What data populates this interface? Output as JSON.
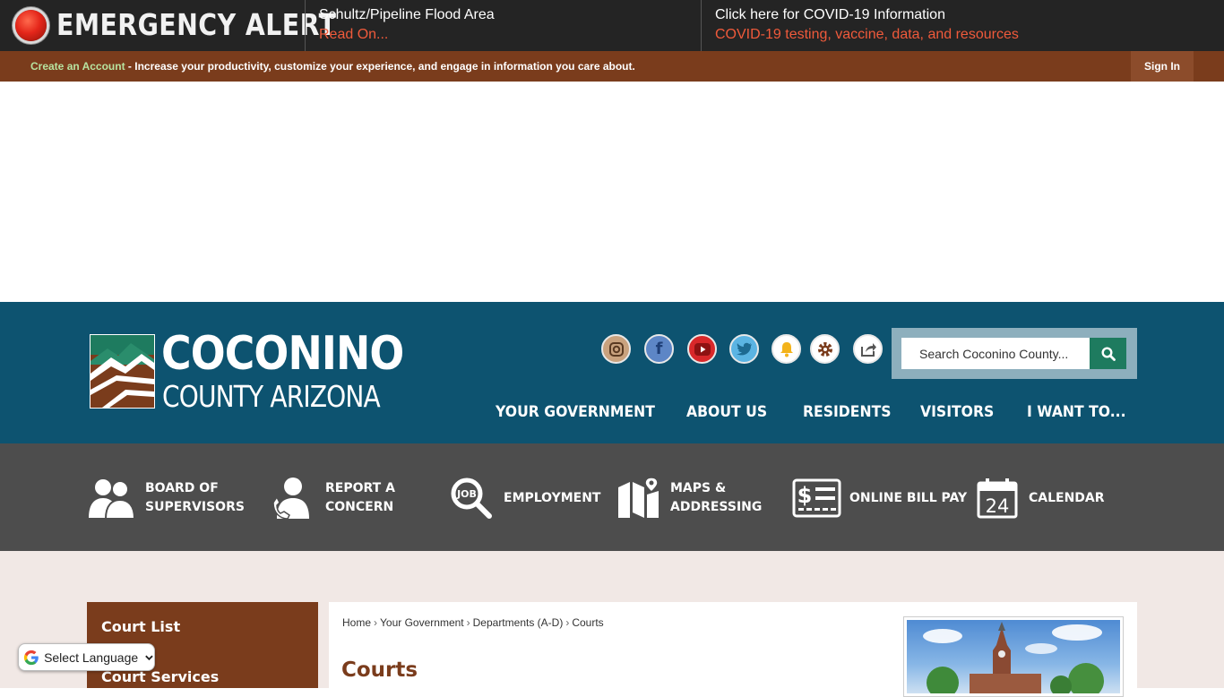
{
  "alert": {
    "title": "EMERGENCY ALERT",
    "items": [
      {
        "headline": "Schultz/Pipeline Flood Area",
        "link": "Read On..."
      },
      {
        "headline": "Click here for COVID-19 Information",
        "link": "COVID-19 testing, vaccine, data, and resources"
      }
    ]
  },
  "account": {
    "create_link": "Create an Account",
    "message": " - Increase your productivity, customize your experience, and engage in information you care about.",
    "sign_in": "Sign In"
  },
  "header": {
    "logo_line1": "COCONINO",
    "logo_line2": "COUNTY ARIZONA",
    "social_icons": [
      "instagram-icon",
      "facebook-icon",
      "youtube-icon",
      "twitter-icon",
      "notify-bell-icon",
      "settings-gear-icon",
      "share-icon"
    ],
    "search_placeholder": "Search Coconino County...",
    "nav": [
      "YOUR GOVERNMENT",
      "ABOUT US",
      "RESIDENTS",
      "VISITORS",
      "I WANT TO..."
    ]
  },
  "quick_links": [
    {
      "label": "BOARD OF\nSUPERVISORS",
      "icon": "people-icon"
    },
    {
      "label": "REPORT A\nCONCERN",
      "icon": "person-phone-icon"
    },
    {
      "label": "EMPLOYMENT",
      "icon": "job-search-icon"
    },
    {
      "label": "MAPS &\nADDRESSING",
      "icon": "map-pin-icon"
    },
    {
      "label": "ONLINE BILL PAY",
      "icon": "bill-icon"
    },
    {
      "label": "CALENDAR",
      "icon": "calendar-icon",
      "day": "24"
    }
  ],
  "sidebar": {
    "items": [
      "Court List",
      "Court Services"
    ]
  },
  "breadcrumb": [
    "Home",
    "Your Government",
    "Departments (A-D)",
    "Courts"
  ],
  "page_title": "Courts",
  "translate": {
    "label": "Select Language"
  },
  "colors": {
    "alert_bg": "#242424",
    "account_bg": "#7a3c1c",
    "header_bg": "#0d5370",
    "quick_bg": "#4d4d4d",
    "search_btn": "#1e7b5f"
  }
}
